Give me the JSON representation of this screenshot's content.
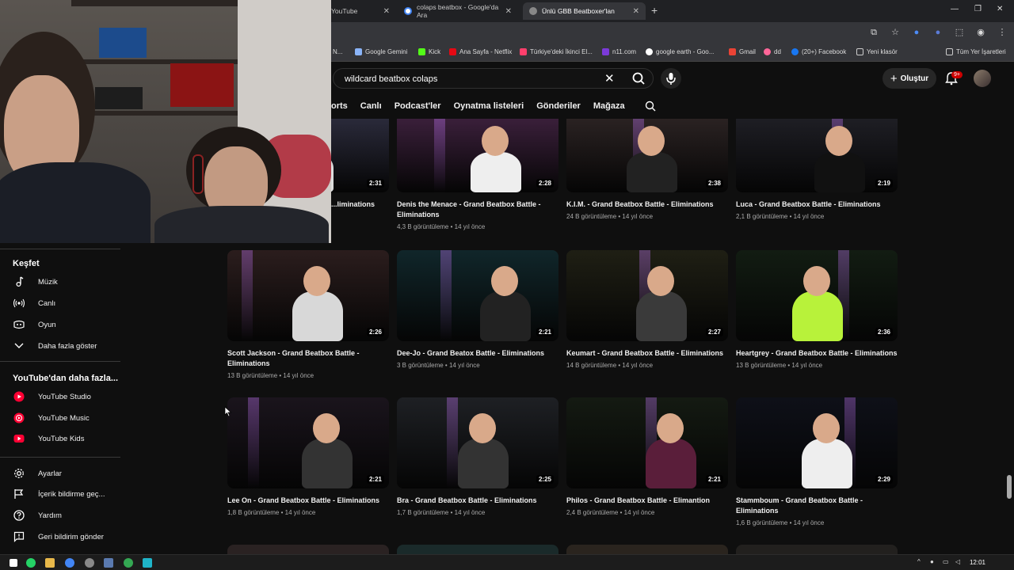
{
  "browser": {
    "tabs": [
      {
        "title": "YouTube",
        "favicon_color": "#ff0000"
      },
      {
        "title": "colaps beatbox - Google'da Ara",
        "favicon_color": "#4285f4"
      },
      {
        "title": "Ünlü GBB Beatboxer'lan",
        "favicon_color": "#aaaaaa"
      }
    ],
    "bookmarks": [
      {
        "label": "N...",
        "color": "#888888"
      },
      {
        "label": "Google Gemini",
        "color": "#8ab4f8"
      },
      {
        "label": "Kick",
        "color": "#53fc18"
      },
      {
        "label": "Ana Sayfa - Netflix",
        "color": "#e50914"
      },
      {
        "label": "Türkiye'deki İkinci El...",
        "color": "#ff3f6c"
      },
      {
        "label": "n11.com",
        "color": "#7b3ad9"
      },
      {
        "label": "google earth - Goo...",
        "color": "#4285f4"
      },
      {
        "label": "Gmail",
        "color": "#ea4335"
      },
      {
        "label": "dd",
        "color": "#ff6699"
      },
      {
        "label": "(20+) Facebook",
        "color": "#1877f2"
      },
      {
        "label": "Yeni klasör",
        "color": "#cccccc"
      },
      {
        "label": "Tüm Yer İşaretleri",
        "color": "#cccccc"
      }
    ]
  },
  "header": {
    "search_value": "wildcard beatbox colaps",
    "create_label": "Oluştur",
    "notif_badge": "9+"
  },
  "chips": [
    "orts",
    "Canlı",
    "Podcast'ler",
    "Oynatma listeleri",
    "Gönderiler",
    "Mağaza"
  ],
  "sidebar": {
    "explore_title": "Keşfet",
    "explore_items": [
      {
        "label": "Müzik",
        "icon": "music-note-icon"
      },
      {
        "label": "Canlı",
        "icon": "live-icon"
      },
      {
        "label": "Oyun",
        "icon": "gamepad-icon"
      },
      {
        "label": "Daha fazla göster",
        "icon": "chevron-down-icon"
      }
    ],
    "more_title": "YouTube'dan daha fazla...",
    "more_items": [
      {
        "label": "YouTube Studio",
        "icon": "youtube-studio-icon"
      },
      {
        "label": "YouTube Music",
        "icon": "youtube-music-icon"
      },
      {
        "label": "YouTube Kids",
        "icon": "youtube-kids-icon"
      }
    ],
    "settings_items": [
      {
        "label": "Ayarlar",
        "icon": "gear-icon"
      },
      {
        "label": "İçerik bildirme geç...",
        "icon": "flag-icon"
      },
      {
        "label": "Yardım",
        "icon": "help-icon"
      },
      {
        "label": "Geri bildirim gönder",
        "icon": "feedback-icon"
      }
    ]
  },
  "videos": [
    {
      "title": "...liminations",
      "meta": "",
      "duration": "2:31",
      "bg": "#2a2a3a"
    },
    {
      "title": "Denis the Menace - Grand Beatbox Battle - Eliminations",
      "meta": "4,3 B görüntüleme • 14 yıl önce",
      "duration": "2:28",
      "bg": "#3a1f3a"
    },
    {
      "title": "K.I.M. - Grand Beatbox Battle - Eliminations",
      "meta": "24 B görüntüleme • 14 yıl önce",
      "duration": "2:38",
      "bg": "#2a2222"
    },
    {
      "title": "Luca - Grand Beatbox Battle - Eliminations",
      "meta": "2,1 B görüntüleme • 14 yıl önce",
      "duration": "2:19",
      "bg": "#1e1e24"
    },
    {
      "title": "Scott Jackson - Grand Beatbox Battle - Eliminations",
      "meta": "13 B görüntüleme • 14 yıl önce",
      "duration": "2:26",
      "bg": "#2b1d1d"
    },
    {
      "title": "Dee-Jo - Grand Beatox Battle - Eliminations",
      "meta": "3 B görüntüleme • 14 yıl önce",
      "duration": "2:21",
      "bg": "#10262a"
    },
    {
      "title": "Keumart - Grand Beatbox Battle - Eliminations",
      "meta": "14 B görüntüleme • 14 yıl önce",
      "duration": "2:27",
      "bg": "#1f1f14"
    },
    {
      "title": "Heartgrey - Grand Beatbox Battle - Eliminations",
      "meta": "13 B görüntüleme • 14 yıl önce",
      "duration": "2:36",
      "bg": "#121c12"
    },
    {
      "title": "Lee On - Grand Beatbox Battle - Eliminations",
      "meta": "1,8 B görüntüleme • 14 yıl önce",
      "duration": "2:21",
      "bg": "#1a141c"
    },
    {
      "title": "Bra - Grand Beatbox Battle - Eliminations",
      "meta": "1,7 B görüntüleme • 14 yıl önce",
      "duration": "2:25",
      "bg": "#1e2024"
    },
    {
      "title": "Philos - Grand Beatbox Battle - Elimantion",
      "meta": "2,4 B görüntüleme • 14 yıl önce",
      "duration": "2:21",
      "bg": "#141a12"
    },
    {
      "title": "Stammboum - Grand Beatbox Battle - Eliminations",
      "meta": "1,6 B görüntüleme • 14 yıl önce",
      "duration": "2:29",
      "bg": "#0e1018"
    }
  ],
  "taskbar": {
    "time": "12:01"
  }
}
